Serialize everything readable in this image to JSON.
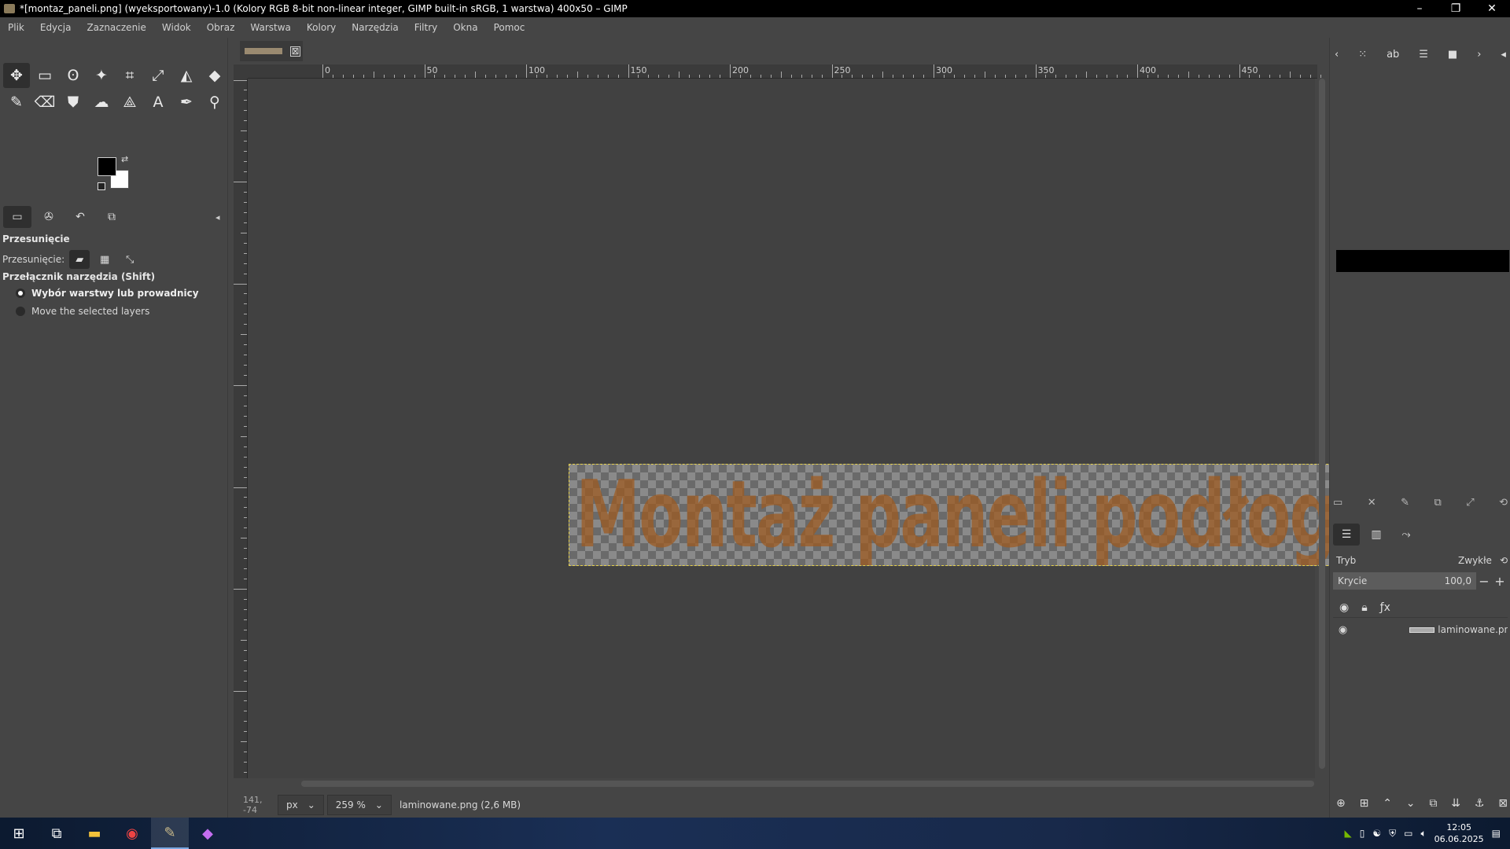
{
  "window": {
    "title": "*[montaz_paneli.png] (wyeksportowany)-1.0 (Kolory RGB 8-bit non-linear integer, GIMP built-in sRGB, 1 warstwa) 400x50 – GIMP",
    "minimize": "–",
    "restore": "❐",
    "close": "✕"
  },
  "menu": [
    "Plik",
    "Edycja",
    "Zaznaczenie",
    "Widok",
    "Obraz",
    "Warstwa",
    "Kolory",
    "Narzędzia",
    "Filtry",
    "Okna",
    "Pomoc"
  ],
  "tools": [
    {
      "name": "move-tool-icon",
      "glyph": "✥"
    },
    {
      "name": "rect-select-tool-icon",
      "glyph": "▭"
    },
    {
      "name": "free-select-tool-icon",
      "glyph": "ʘ"
    },
    {
      "name": "fuzzy-select-tool-icon",
      "glyph": "✦"
    },
    {
      "name": "crop-tool-icon",
      "glyph": "⌗"
    },
    {
      "name": "unified-transform-tool-icon",
      "glyph": "⤢"
    },
    {
      "name": "warp-transform-tool-icon",
      "glyph": "◭"
    },
    {
      "name": "bucket-fill-tool-icon",
      "glyph": "◆"
    },
    {
      "name": "paintbrush-tool-icon",
      "glyph": "✎"
    },
    {
      "name": "eraser-tool-icon",
      "glyph": "⌫"
    },
    {
      "name": "clone-tool-icon",
      "glyph": "⛊"
    },
    {
      "name": "smudge-tool-icon",
      "glyph": "☁"
    },
    {
      "name": "paths-tool-icon",
      "glyph": "⟁"
    },
    {
      "name": "text-tool-icon",
      "glyph": "A"
    },
    {
      "name": "color-picker-tool-icon",
      "glyph": "✒"
    },
    {
      "name": "zoom-tool-icon",
      "glyph": "⚲"
    }
  ],
  "tool_options": {
    "title": "Przesunięcie",
    "move_label": "Przesunięcie:",
    "switch_label": "Przełącznik narzędzia  (Shift)",
    "radio_1": "Wybór warstwy lub prowadnicy",
    "radio_2": "Move the selected layers"
  },
  "ruler": {
    "h_labels": [
      "0",
      "50",
      "100",
      "150",
      "200",
      "250",
      "300",
      "350",
      "400",
      "450"
    ],
    "v_labels": [
      "150",
      "100",
      "50",
      "0",
      "50",
      "100",
      "150"
    ]
  },
  "image": {
    "tab_close": "⊠",
    "text": "Montaż paneli podłogowych"
  },
  "status": {
    "coords": "141, -74",
    "unit": "px",
    "zoom": "259 %",
    "info": "laminowane.png (2,6 MB)"
  },
  "layers": {
    "mode_label": "Tryb",
    "mode_value": "Zwykłe",
    "opacity_label": "Krycie",
    "opacity_value": "100,0",
    "layer_name": "laminowane.png"
  },
  "taskbar": {
    "time": "12:05",
    "date": "06.06.2025"
  }
}
